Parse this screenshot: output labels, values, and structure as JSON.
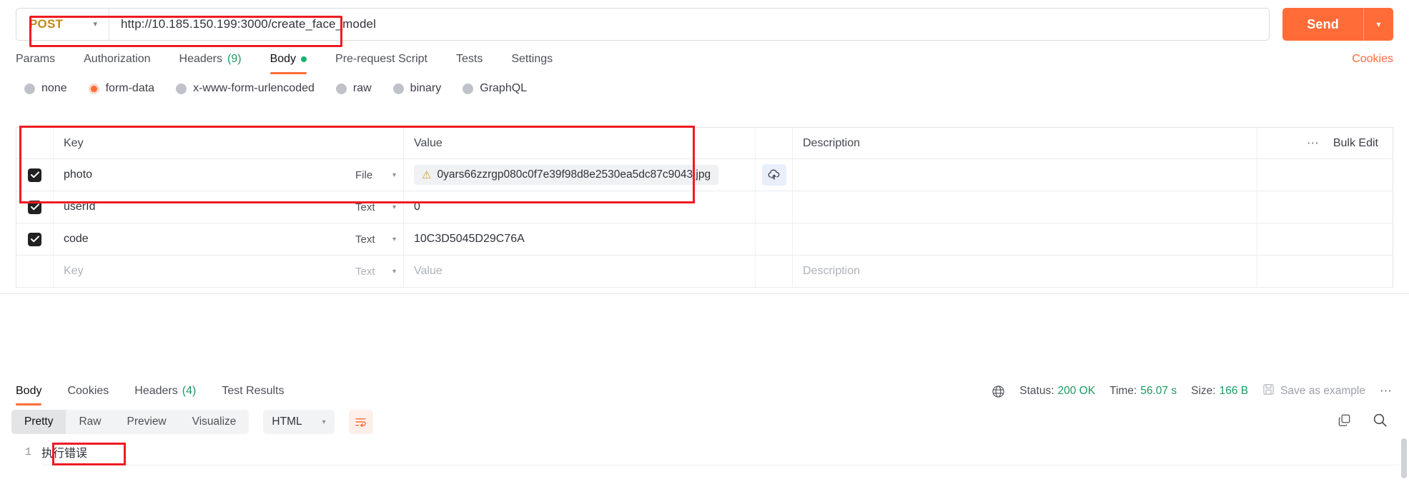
{
  "request": {
    "method": "POST",
    "url": "http://10.185.150.199:3000/create_face_model",
    "send_label": "Send",
    "send_caret": "chevron-down",
    "tabs": [
      {
        "label": "Params",
        "count": null,
        "active": false,
        "dot": false
      },
      {
        "label": "Authorization",
        "count": null,
        "active": false,
        "dot": false
      },
      {
        "label": "Headers",
        "count": "(9)",
        "active": false,
        "dot": false
      },
      {
        "label": "Body",
        "count": null,
        "active": true,
        "dot": true
      },
      {
        "label": "Pre-request Script",
        "count": null,
        "active": false,
        "dot": false
      },
      {
        "label": "Tests",
        "count": null,
        "active": false,
        "dot": false
      },
      {
        "label": "Settings",
        "count": null,
        "active": false,
        "dot": false
      }
    ],
    "cookies_link": "Cookies",
    "body_types": [
      {
        "label": "none",
        "selected": false
      },
      {
        "label": "form-data",
        "selected": true
      },
      {
        "label": "x-www-form-urlencoded",
        "selected": false
      },
      {
        "label": "raw",
        "selected": false
      },
      {
        "label": "binary",
        "selected": false
      },
      {
        "label": "GraphQL",
        "selected": false
      }
    ],
    "table": {
      "headers": {
        "key": "Key",
        "value": "Value",
        "description": "Description"
      },
      "bulk_edit": "Bulk Edit",
      "options_icon": "ellipsis-icon",
      "rows": [
        {
          "checked": true,
          "key": "photo",
          "type": "File",
          "value": "0yars66zzrgp080c0f7e39f98d8e2530ea5dc87c9043.jpg",
          "is_file": true,
          "warning": true,
          "description": "",
          "upload_icon": "cloud-upload-icon"
        },
        {
          "checked": true,
          "key": "userId",
          "type": "Text",
          "value": "0",
          "is_file": false,
          "warning": false,
          "description": "",
          "upload_icon": null
        },
        {
          "checked": true,
          "key": "code",
          "type": "Text",
          "value": "10C3D5045D29C76A",
          "is_file": false,
          "warning": false,
          "description": "",
          "upload_icon": null
        }
      ],
      "empty_row": {
        "key_placeholder": "Key",
        "type": "Text",
        "value_placeholder": "Value",
        "description_placeholder": "Description"
      }
    }
  },
  "response": {
    "tabs": [
      {
        "label": "Body",
        "count": null,
        "active": true
      },
      {
        "label": "Cookies",
        "count": null,
        "active": false
      },
      {
        "label": "Headers",
        "count": "(4)",
        "active": false
      },
      {
        "label": "Test Results",
        "count": null,
        "active": false
      }
    ],
    "globe_icon": "globe-icon",
    "status_label": "Status:",
    "status_value": "200 OK",
    "time_label": "Time:",
    "time_value": "56.07 s",
    "size_label": "Size:",
    "size_value": "166 B",
    "save_example": "Save as example",
    "save_icon": "floppy-disk-icon",
    "more_icon": "ellipsis-icon",
    "viewer": {
      "modes": [
        {
          "label": "Pretty",
          "active": true
        },
        {
          "label": "Raw",
          "active": false
        },
        {
          "label": "Preview",
          "active": false
        },
        {
          "label": "Visualize",
          "active": false
        }
      ],
      "format": "HTML",
      "format_caret": "chevron-down",
      "wrap_icon": "word-wrap-icon",
      "copy_icon": "copy-icon",
      "search_icon": "search-icon"
    },
    "body_lines": [
      {
        "number": "1",
        "text": "执行错误"
      }
    ]
  },
  "colors": {
    "accent": "#ff6c37",
    "method": "#c0881b",
    "success": "#1a9b63",
    "annotation": "#ee1b23"
  }
}
